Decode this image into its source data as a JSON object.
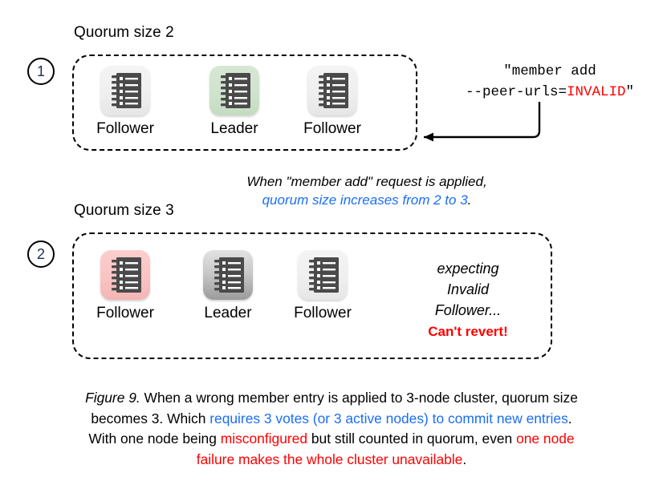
{
  "figure": {
    "number_label": "Figure 9.",
    "caption_parts": [
      {
        "text": " When a wrong member entry is applied to 3-node cluster, quorum size becomes 3. Which ",
        "color": "black"
      },
      {
        "text": "requires 3 votes (or 3 active nodes) to commit new entries",
        "color": "blue"
      },
      {
        "text": ". With one node being ",
        "color": "black"
      },
      {
        "text": "misconfigured",
        "color": "red"
      },
      {
        "text": " but still counted in quorum, even ",
        "color": "black"
      },
      {
        "text": "one node failure makes the whole cluster unavailable",
        "color": "red"
      },
      {
        "text": ".",
        "color": "black"
      }
    ],
    "caption_line1": "Figure 9. When a wrong member entry is applied to 3-node cluster, quorum size",
    "caption_line2a": "becomes 3. Which ",
    "caption_line2b": "requires 3 votes (or 3 active nodes) to commit new entries",
    "caption_line2c": ".",
    "caption_line3a": "With one node being ",
    "caption_line3b": "misconfigured",
    "caption_line3c": " but still counted in quorum, even ",
    "caption_line3d": "one node",
    "caption_line4a": "failure makes the whole cluster unavailable",
    "caption_line4b": "."
  },
  "colors": {
    "blue": "#1a6ef5",
    "red": "#ff0000",
    "leader_green": "#cfe3cd",
    "invalid_pink": "#f8c4c2",
    "node_gray": "#efefef",
    "step_number": "#1d2b58"
  },
  "panels": [
    {
      "step": "1",
      "quorum_label": "Quorum size 2",
      "nodes": [
        {
          "label": "Follower",
          "state": "normal",
          "tile": "plain"
        },
        {
          "label": "Leader",
          "state": "leader",
          "tile": "green"
        },
        {
          "label": "Follower",
          "state": "normal",
          "tile": "plain"
        }
      ]
    },
    {
      "step": "2",
      "quorum_label": "Quorum size 3",
      "nodes": [
        {
          "label": "Follower",
          "state": "misconfigured",
          "tile": "pink"
        },
        {
          "label": "Leader",
          "state": "leader",
          "tile": "graygrad"
        },
        {
          "label": "Follower",
          "state": "normal",
          "tile": "plain"
        }
      ],
      "side_note_line1": "expecting",
      "side_note_line2": "Invalid",
      "side_note_line3": "Follower...",
      "side_alert": "Can't revert!"
    }
  ],
  "command": {
    "line1": "\"member add",
    "line2_prefix": "--peer-urls=",
    "line2_invalid": "INVALID",
    "line2_suffix": "\""
  },
  "transition": {
    "line1": "When \"member add\" request is applied,",
    "line2_blue": "quorum size increases from 2 to 3",
    "line2_tail": "."
  }
}
